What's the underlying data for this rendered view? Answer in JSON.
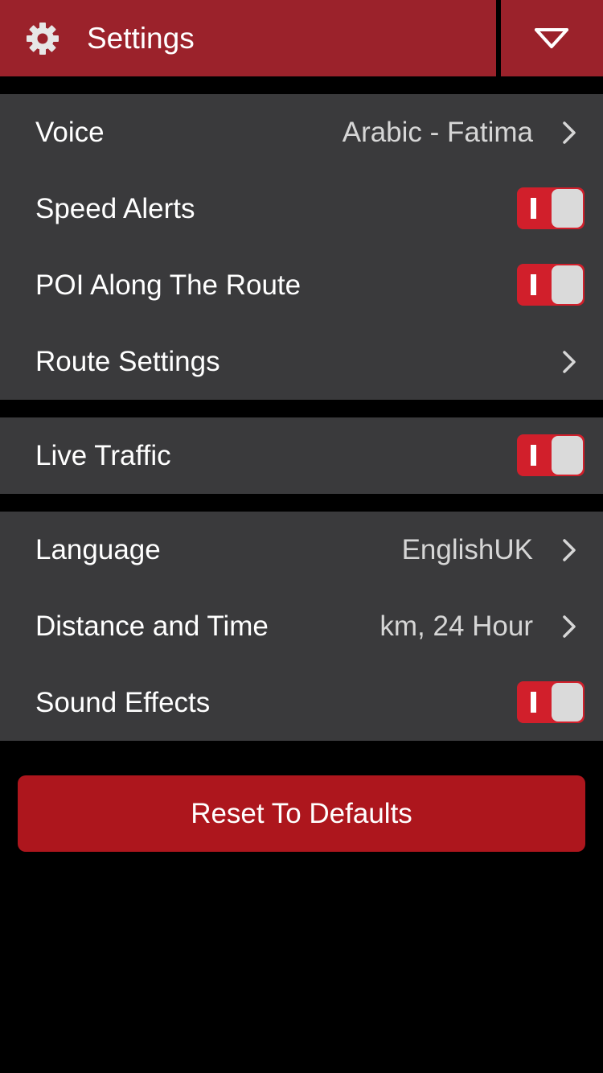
{
  "header": {
    "title": "Settings",
    "settings_icon": "gear-icon",
    "menu_icon": "chevron-down-icon"
  },
  "groups": [
    {
      "items": [
        {
          "label": "Voice",
          "value": "Arabic - Fatima",
          "type": "link"
        },
        {
          "label": "Speed Alerts",
          "type": "toggle",
          "on": true
        },
        {
          "label": "POI Along The Route",
          "type": "toggle",
          "on": true
        },
        {
          "label": "Route Settings",
          "value": "",
          "type": "link"
        }
      ]
    },
    {
      "items": [
        {
          "label": "Live Traffic",
          "type": "toggle",
          "on": true
        }
      ]
    },
    {
      "items": [
        {
          "label": "Language",
          "value": "EnglishUK",
          "type": "link"
        },
        {
          "label": "Distance and Time",
          "value": "km, 24 Hour",
          "type": "link"
        },
        {
          "label": "Sound Effects",
          "type": "toggle",
          "on": true
        }
      ]
    }
  ],
  "reset_button": {
    "label": "Reset To Defaults"
  },
  "colors": {
    "header": "#9b222b",
    "row_bg": "#3a3a3c",
    "toggle_on": "#d11f2b",
    "reset_button": "#ad161d"
  }
}
